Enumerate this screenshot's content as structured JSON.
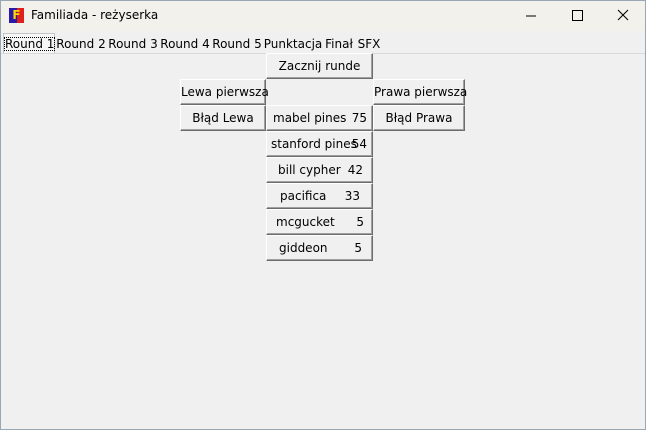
{
  "window": {
    "title": "Familiada - reżyserka",
    "app_icon_letter": "F",
    "icon_colors": {
      "left": "#2a1aa8",
      "right": "#e0201a",
      "letter": "#ffd800"
    }
  },
  "tabs": [
    {
      "label": "Round 1",
      "active": true
    },
    {
      "label": "Round 2",
      "active": false
    },
    {
      "label": "Round 3",
      "active": false
    },
    {
      "label": "Round 4",
      "active": false
    },
    {
      "label": "Round 5",
      "active": false
    },
    {
      "label": "Punktacja",
      "active": false
    },
    {
      "label": "Finał",
      "active": false
    },
    {
      "label": "SFX",
      "active": false
    }
  ],
  "round": {
    "start_button": "Zacznij runde",
    "left_first_button": "Lewa pierwsza",
    "right_first_button": "Prawa pierwsza",
    "left_error_button": "Błąd Lewa",
    "right_error_button": "Błąd Prawa",
    "answers": [
      {
        "text": "mabel pines",
        "points": "75"
      },
      {
        "text": "stanford pines",
        "points": "54"
      },
      {
        "text": "bill cypher",
        "points": "42"
      },
      {
        "text": "pacifica",
        "points": "33"
      },
      {
        "text": "mcgucket",
        "points": "5"
      },
      {
        "text": "giddeon",
        "points": "5"
      }
    ]
  }
}
